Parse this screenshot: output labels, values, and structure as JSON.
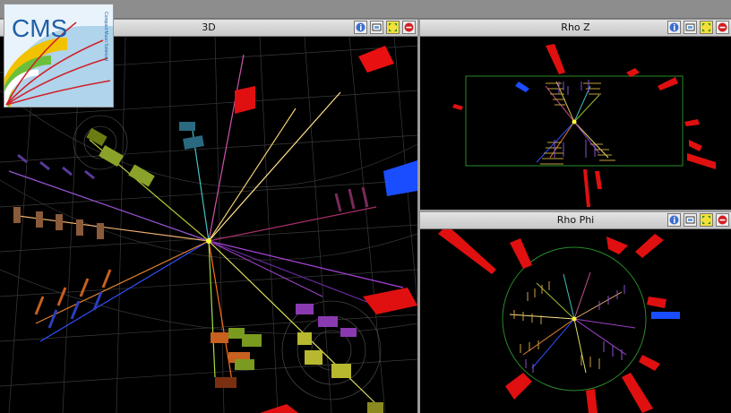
{
  "window": {
    "logo": {
      "text": "CMS",
      "subtext": "Compact Muon Solenoid"
    }
  },
  "panels": {
    "view3d": {
      "title": "3D"
    },
    "rhoz": {
      "title": "Rho Z"
    },
    "rhophi": {
      "title": "Rho Phi"
    }
  },
  "toolbar_icons": [
    "info-icon",
    "screenshot-icon",
    "maximize-icon",
    "close-icon"
  ],
  "colors": {
    "background": "#000000",
    "hcal": "#ff1a1a",
    "ecal_blue": "#1a4dff",
    "vertex": "#ffff33",
    "tracker_circle": "#2a8a2a"
  }
}
